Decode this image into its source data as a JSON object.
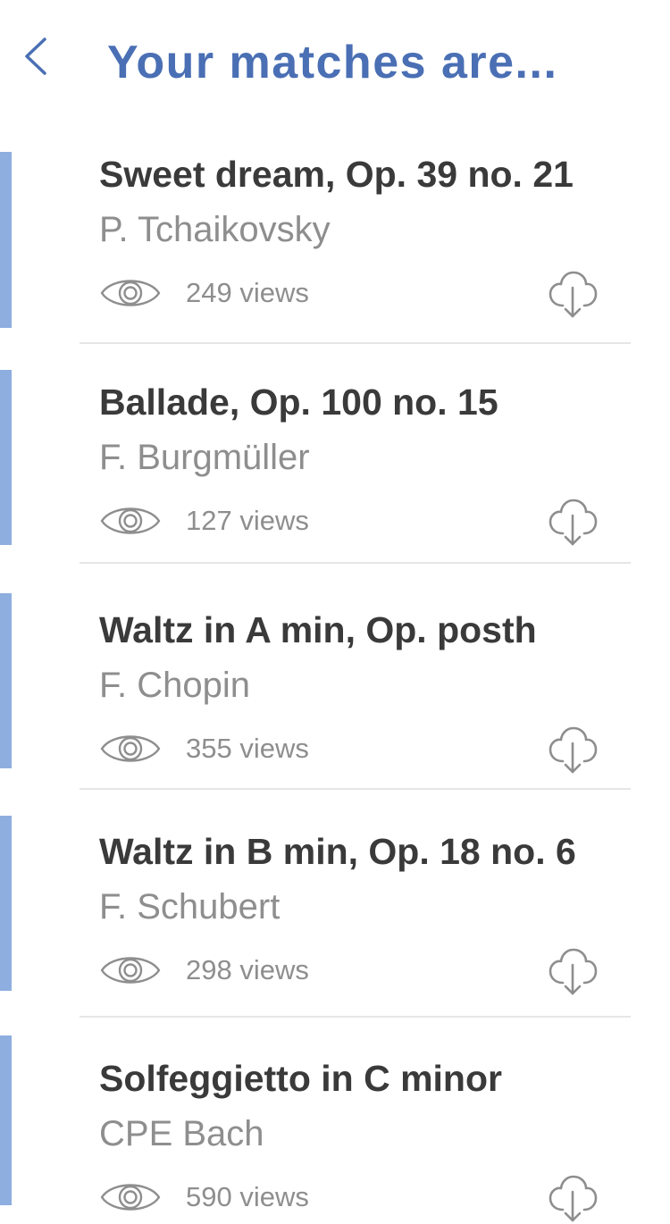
{
  "header": {
    "back_icon": "chevron-left-icon",
    "title": "Your matches are..."
  },
  "colors": {
    "title": "#4a6fb4",
    "back_icon": "#4a6fb4",
    "accent_bar": "#8eaee0",
    "title_text": "#3a3a3a",
    "secondary_text": "#8e8e8e",
    "icon": "#8e8e8e",
    "divider": "#e6e6e6"
  },
  "matches": [
    {
      "title": "Sweet dream, Op. 39 no. 21",
      "composer": "P. Tchaikovsky",
      "views": "249 views",
      "view_icon": "eye-icon",
      "download_icon": "cloud-download-icon"
    },
    {
      "title": "Ballade, Op. 100 no. 15",
      "composer": "F. Burgmüller",
      "views": "127 views",
      "view_icon": "eye-icon",
      "download_icon": "cloud-download-icon"
    },
    {
      "title": "Waltz in A min, Op. posth",
      "composer": "F. Chopin",
      "views": "355 views",
      "view_icon": "eye-icon",
      "download_icon": "cloud-download-icon"
    },
    {
      "title": "Waltz in B min, Op. 18 no. 6",
      "composer": "F. Schubert",
      "views": "298 views",
      "view_icon": "eye-icon",
      "download_icon": "cloud-download-icon"
    },
    {
      "title": "Solfeggietto in C minor",
      "composer": "CPE Bach",
      "views": "590 views",
      "view_icon": "eye-icon",
      "download_icon": "cloud-download-icon"
    }
  ]
}
